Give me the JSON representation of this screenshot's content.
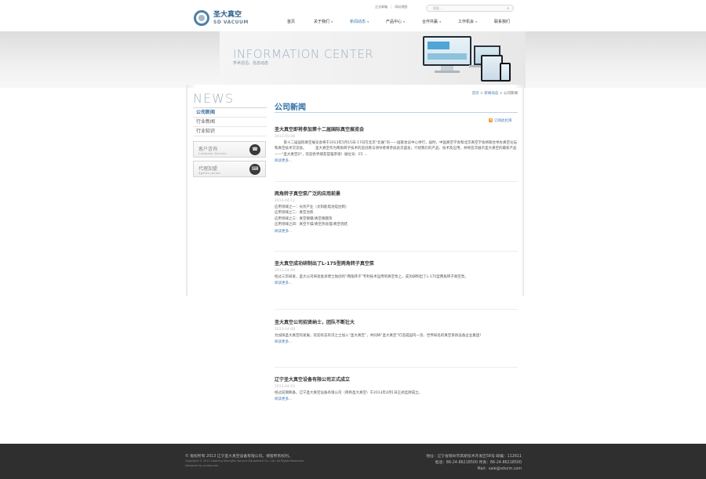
{
  "header": {
    "logo_cn": "圣大真空",
    "logo_en": "SD VACUUM",
    "top_links": [
      "企业邮箱",
      "网站地图"
    ],
    "search_placeholder": "搜索...",
    "nav": [
      {
        "label": "首页",
        "has_dropdown": false,
        "active": false
      },
      {
        "label": "关于我们",
        "has_dropdown": true,
        "active": false
      },
      {
        "label": "新闻动态",
        "has_dropdown": true,
        "active": true
      },
      {
        "label": "产品中心",
        "has_dropdown": true,
        "active": false
      },
      {
        "label": "合作共赢",
        "has_dropdown": true,
        "active": false
      },
      {
        "label": "工作机会",
        "has_dropdown": true,
        "active": false
      },
      {
        "label": "联系我们",
        "has_dropdown": false,
        "active": false
      }
    ]
  },
  "banner": {
    "title": "INFORMATION CENTER",
    "subtitle": "学术前沿、信息动态"
  },
  "sidebar": {
    "title": "NEWS",
    "items": [
      {
        "label": "公司新闻",
        "active": true
      },
      {
        "label": "行业新闻",
        "active": false
      },
      {
        "label": "行业知识",
        "active": false
      }
    ],
    "boxes": [
      {
        "title": "客户咨询",
        "subtitle": "Customer Service",
        "icon": "headset-icon"
      },
      {
        "title": "代理加盟",
        "subtitle": "Agents Joined",
        "icon": "keyboard-icon"
      }
    ]
  },
  "breadcrumb": {
    "items": [
      "首页",
      "新闻动态",
      "公司新闻"
    ],
    "separator": ">"
  },
  "main": {
    "title": "公司新闻",
    "rss_label": "订阅此栏目",
    "articles": [
      {
        "title": "圣大真空即将参加第十二届国际真空展览会",
        "date": "2013-05-08",
        "body": [
          "        第十二届国际真空展览会将于2013年5月15日-17日在北京“北展”的——国家会议中心举行，届时，中国真空学会和北京真空学会将联合举办真空论坛和真空技术交流会。        圣大真空作为两角转子技术的首创者与领导者将参加此次盛会，介绍我们的产品、技术及应用，并将首次展示圣大真空的最新产品——“圣大真空D”，欢迎各界朋友莅临参观！展位号：E5 ..."
        ],
        "more": "阅读更多..."
      },
      {
        "title": "两角转子真空泵广泛的应用前景",
        "date": "2013-04-11",
        "body": [
          "应用领域之一：光伏产业（太阳能电池硅拉制）",
          "应用领域之二：真空冶炼",
          "应用领域之三：真空镀膜/真空镀膜等",
          "应用领域之四：真空干燥/真空热处理/真空烧结"
        ],
        "more": "阅读更多..."
      },
      {
        "title": "圣大真空成功研制出了L-175型两角转子真空泵",
        "date": "2013-04-09",
        "body": [
          "经过三年研发，圣大公司将高金泽博士独创的“两角转子”专利技术运用到真空泵上，成功研制出了L-175型两角转子真空泵。"
        ],
        "more": "阅读更多..."
      },
      {
        "title": "圣大真空公司招贤纳士，团队不断壮大",
        "date": "2013-04-08",
        "body": [
          "为加快圣大真空的发展，欢迎有志有识之士加入“圣大真空”，共同将“圣大真空”打造成国内一流、世界知名的真空系统设备企业集团！"
        ],
        "more": "阅读更多..."
      },
      {
        "title": "辽宁圣大真空设备有限公司正式成立",
        "date": "2013-04-03",
        "body": [
          "经过前期筹备，辽宁圣大真空设备有限公司（简称圣大真空）于2013年4月1日正式挂牌成立。"
        ],
        "more": "阅读更多..."
      }
    ]
  },
  "footer": {
    "left": [
      "© 版权所有 2013 辽宁圣大真空设备有限公司。保留所有权利。",
      "Copyright © 2013 Liaoning ShengDa Vacuum Equipment Co., Ltd. All Rights Reserved.",
      "Designed by yicaay.com"
    ],
    "right": [
      "地址：辽宁省铁岭市高新技术开发区58号  邮编：112611",
      "电话：86-24-86218500  传真：86-24-86218500",
      "Mail：sale@sdvcm.com"
    ]
  }
}
